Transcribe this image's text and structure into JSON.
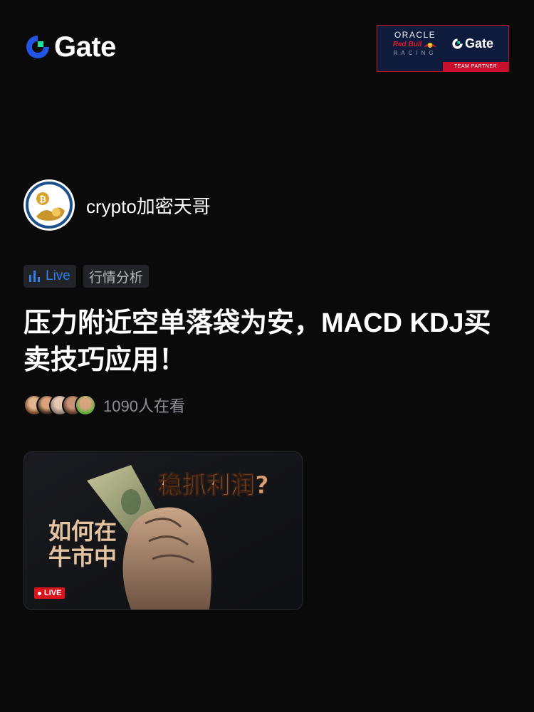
{
  "brand": {
    "name": "Gate"
  },
  "partner": {
    "oracle": "ORACLE",
    "redbull": "Red Bull",
    "racing": "RACING",
    "gate": "Gate",
    "ribbon": "TEAM PARTNER"
  },
  "author": {
    "name": "crypto加密天哥"
  },
  "tags": {
    "live": "Live",
    "category": "行情分析"
  },
  "post": {
    "title": "压力附近空单落袋为安，MACD KDJ买卖技巧应用！"
  },
  "viewers": {
    "count_text": "1090人在看",
    "avatar_count": 5
  },
  "thumbnail": {
    "text_top_right": "稳抓利润?",
    "text_left_1": "如何在",
    "text_left_2": "牛市中",
    "badge": "LIVE"
  },
  "colors": {
    "background": "#0a0a0b",
    "accent_blue": "#2f80ed",
    "live_red": "#d9141d",
    "gate_teal": "#17e6a1"
  }
}
